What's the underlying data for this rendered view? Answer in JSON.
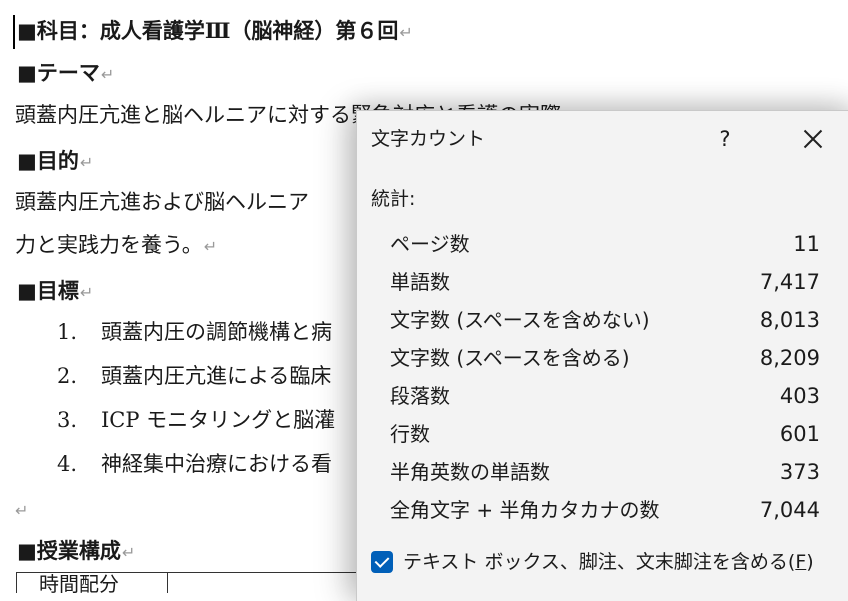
{
  "document": {
    "heading1": "■科目：成人看護学Ⅲ（脳神経）第６回",
    "theme_heading": "■テーマ",
    "theme_text": "頭蓋内圧亢進と脳ヘルニアに対する緊急対応と看護の実際",
    "purpose_heading": "■目的",
    "purpose_text_1": "頭蓋内圧亢進および脳ヘルニア",
    "purpose_text_2": "力と実践力を養う。",
    "goals_heading": "■目標",
    "goals": [
      {
        "num": "1.",
        "text": "頭蓋内圧の調節機構と病"
      },
      {
        "num": "2.",
        "text": "頭蓋内圧亢進による臨床"
      },
      {
        "num": "3.",
        "text": "ICP モニタリングと脳灌"
      },
      {
        "num": "4.",
        "text": "神経集中治療における看"
      }
    ],
    "lesson_heading": "■授業構成",
    "table_first_cell": "時間配分",
    "paragraph_mark": "↵"
  },
  "dialog": {
    "title": "文字カウント",
    "help_label": "?",
    "stats_label": "統計:",
    "stats": [
      {
        "label": "ページ数",
        "value": "11"
      },
      {
        "label": "単語数",
        "value": "7,417"
      },
      {
        "label": "文字数 (スペースを含めない)",
        "value": "8,013"
      },
      {
        "label": "文字数 (スペースを含める)",
        "value": "8,209"
      },
      {
        "label": "段落数",
        "value": "403"
      },
      {
        "label": "行数",
        "value": "601"
      },
      {
        "label": "半角英数の単語数",
        "value": "373"
      },
      {
        "label": "全角文字 + 半角カタカナの数",
        "value": "7,044"
      }
    ],
    "include_textboxes_label": "テキスト ボックス、脚注、文末脚注を含める(",
    "include_textboxes_key": "F",
    "include_textboxes_close": ")",
    "include_textboxes_checked": true
  },
  "colors": {
    "checkbox_accent": "#005fb8",
    "dialog_background": "#f3f3f3"
  }
}
